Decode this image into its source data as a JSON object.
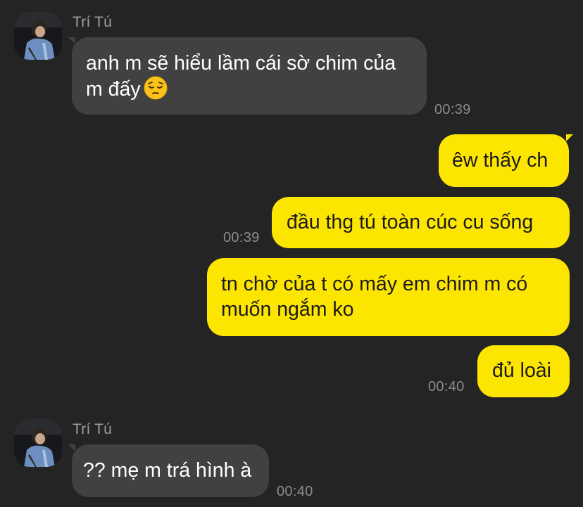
{
  "messages": [
    {
      "sender": "Trí Tú",
      "lines": [
        "anh m sẽ hiểu lầm cái sờ chim của",
        "m đấy"
      ],
      "emoji_icon": "pensive-face-icon",
      "time": "00:39"
    },
    {
      "text": "êw thấy ch"
    },
    {
      "text": "đầu thg tú toàn cúc cu sống",
      "time": "00:39"
    },
    {
      "lines": [
        "tn chờ của t có mấy em chim m có",
        "muốn ngắm ko"
      ]
    },
    {
      "text": "đủ loài",
      "time": "00:40"
    },
    {
      "sender": "Trí Tú",
      "text": "?? mẹ m trá hình à",
      "time": "00:40"
    }
  ],
  "colors": {
    "background": "#242424",
    "incoming_bubble": "#414141",
    "outgoing_bubble": "#fde502",
    "timestamp": "#8c8c8c",
    "sender_name": "#9e9e9e"
  }
}
